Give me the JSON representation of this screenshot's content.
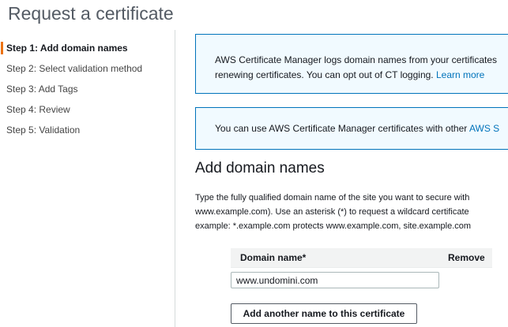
{
  "page": {
    "title": "Request a certificate"
  },
  "steps": [
    {
      "label": "Step 1: Add domain names"
    },
    {
      "label": "Step 2: Select validation method"
    },
    {
      "label": "Step 3: Add Tags"
    },
    {
      "label": "Step 4: Review"
    },
    {
      "label": "Step 5: Validation"
    }
  ],
  "info_ct": {
    "line1": "AWS Certificate Manager logs domain names from your certificates",
    "line2": "renewing certificates. You can opt out of CT logging.",
    "link": "Learn more"
  },
  "info_services": {
    "text": "You can use AWS Certificate Manager certificates with other",
    "link": "AWS S"
  },
  "section": {
    "title": "Add domain names",
    "desc_line1": "Type the fully qualified domain name of the site you want to secure with",
    "desc_line2": "www.example.com). Use an asterisk (*) to request a wildcard certificate",
    "desc_line3": "example: *.example.com protects www.example.com, site.example.com"
  },
  "domain_table": {
    "col_domain": "Domain name*",
    "col_remove": "Remove",
    "value": "www.undomini.com"
  },
  "add_button": "Add another name to this certificate",
  "colors": {
    "accent": "#ec7211",
    "link": "#0073bb",
    "info_bg": "#f1faff"
  }
}
